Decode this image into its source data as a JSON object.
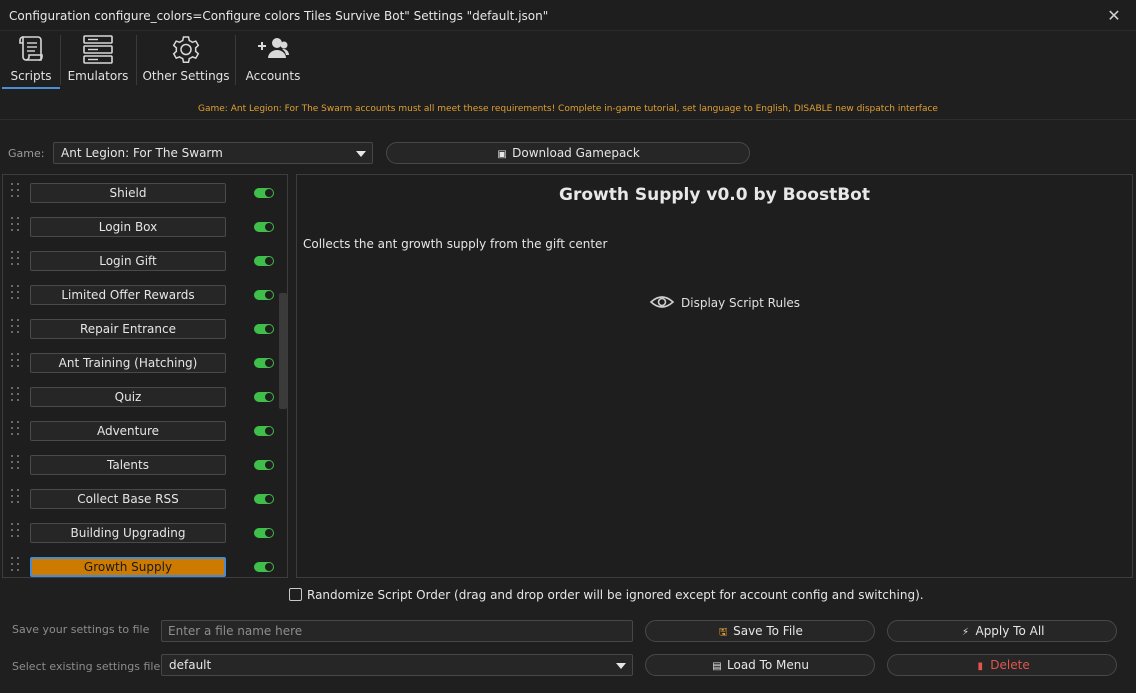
{
  "window": {
    "title": "Configuration configure_colors=Configure colors Tiles Survive Bot\" Settings \"default.json\"",
    "close_glyph": "✕"
  },
  "tabs": [
    {
      "label": "Scripts",
      "icon": "scroll-icon",
      "active": true
    },
    {
      "label": "Emulators",
      "icon": "server-icon",
      "active": false
    },
    {
      "label": "Other Settings",
      "icon": "gear-icon",
      "active": false
    },
    {
      "label": "Accounts",
      "icon": "add-users-icon",
      "active": false
    }
  ],
  "notice": "Game: Ant Legion: For The Swarm accounts must all meet these requirements! Complete in-game tutorial, set language to English, DISABLE new dispatch interface",
  "game": {
    "label": "Game:",
    "selected": "Ant Legion: For The Swarm",
    "download_label": "Download Gamepack"
  },
  "scripts": [
    {
      "name": "Shield",
      "enabled": true,
      "selected": false
    },
    {
      "name": "Login Box",
      "enabled": true,
      "selected": false
    },
    {
      "name": "Login Gift",
      "enabled": true,
      "selected": false
    },
    {
      "name": "Limited Offer Rewards",
      "enabled": true,
      "selected": false
    },
    {
      "name": "Repair Entrance",
      "enabled": true,
      "selected": false
    },
    {
      "name": "Ant Training (Hatching)",
      "enabled": true,
      "selected": false
    },
    {
      "name": "Quiz",
      "enabled": true,
      "selected": false
    },
    {
      "name": "Adventure",
      "enabled": true,
      "selected": false
    },
    {
      "name": "Talents",
      "enabled": true,
      "selected": false
    },
    {
      "name": "Collect Base RSS",
      "enabled": true,
      "selected": false
    },
    {
      "name": "Building Upgrading",
      "enabled": true,
      "selected": false
    },
    {
      "name": "Growth Supply",
      "enabled": true,
      "selected": true
    }
  ],
  "detail": {
    "title": "Growth Supply v0.0 by BoostBot",
    "description": "Collects the ant growth supply from the gift center",
    "rules_label": "Display Script Rules"
  },
  "randomize": {
    "label": "Randomize Script Order (drag and drop order will be ignored except for account config and switching).",
    "checked": false
  },
  "settings": {
    "save_label": "Save your settings to file",
    "filename_placeholder": "Enter a file name here",
    "save_button": "Save To File",
    "apply_all_button": "Apply To All",
    "select_label": "Select existing settings file",
    "selected_file": "default",
    "load_button": "Load To Menu",
    "delete_button": "Delete"
  },
  "colors": {
    "accent": "#4c8ed6",
    "notice": "#e0a030",
    "selected_script": "#cc7a00",
    "toggle_on": "#3fbf4a",
    "delete": "#e0564f"
  }
}
